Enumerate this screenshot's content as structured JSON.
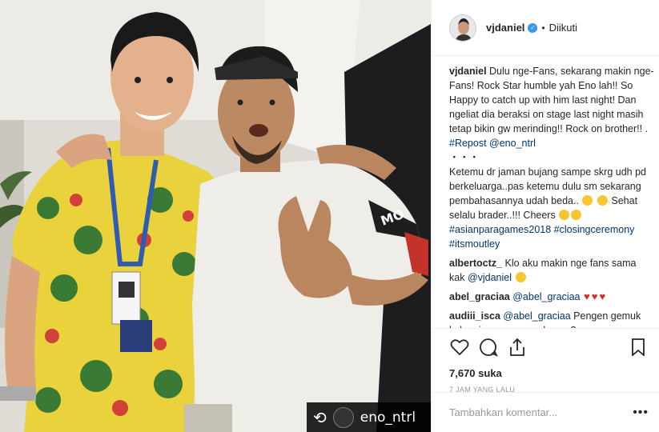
{
  "post": {
    "repost_badge": {
      "icon": "repost-icon",
      "username": "eno_ntrl"
    },
    "shirt_text": "MO"
  },
  "header": {
    "username": "vjdaniel",
    "verified_icon": "verified-badge-icon",
    "dot": "•",
    "follow_status": "Diikuti"
  },
  "comments": [
    {
      "user": "vjdaniel",
      "parts": [
        {
          "t": "Dulu nge-Fans, sekarang makin nge-Fans! Rock Star humble yah Eno lah!! So Happy to catch up with him last night! Dan ngeliat dia beraksi on stage last night masih tetap bikin gw merinding!! Rock on brother!! ."
        },
        {
          "br": true
        },
        {
          "t": "#Repost @eno_ntrl",
          "link": true
        },
        {
          "br": true
        },
        {
          "t": "・・・"
        },
        {
          "br": true
        },
        {
          "t": "Ketemu dr jaman bujang sampe skrg udh pd berkeluarga..pas ketemu dulu sm sekarang pembahasannya udah beda.. "
        },
        {
          "emoji": "rofl"
        },
        {
          "t": " "
        },
        {
          "emoji": "rofl"
        },
        {
          "t": " Sehat selalu brader..!!! Cheers "
        },
        {
          "emoji": "beer"
        },
        {
          "emoji": "beer"
        },
        {
          "br": true
        },
        {
          "t": "#asianparagames2018 #closingceremony",
          "link": true
        },
        {
          "br": true
        },
        {
          "t": "#itsmoutley",
          "link": true
        }
      ]
    },
    {
      "user": "albertoctz_",
      "parts": [
        {
          "t": "Klo aku makin nge fans sama kak "
        },
        {
          "t": "@vjdaniel",
          "link": true
        },
        {
          "t": " "
        },
        {
          "emoji": "grin"
        }
      ]
    },
    {
      "user": "abel_graciaa",
      "parts": [
        {
          "t": "@abel_graciaa",
          "link": true
        },
        {
          "t": " "
        },
        {
          "emoji": "heart"
        },
        {
          "emoji": "heart"
        },
        {
          "emoji": "heart"
        }
      ]
    },
    {
      "user": "audiii_isca",
      "parts": [
        {
          "t": "@abel_graciaa",
          "link": true
        },
        {
          "t": " Pengen gemuk kak.. gimana cara ordernya?"
        }
      ]
    }
  ],
  "actions": {
    "like_icon": "heart-outline-icon",
    "comment_icon": "comment-bubble-icon",
    "share_icon": "share-upload-icon",
    "save_icon": "bookmark-icon",
    "likes": "7,670 suka",
    "time": "7 JAM YANG LALU"
  },
  "add_comment": {
    "placeholder": "Tambahkan komentar...",
    "more": "•••"
  },
  "colors": {
    "link": "#003569",
    "verified": "#3897f0",
    "border": "#efefef",
    "muted": "#999999"
  }
}
